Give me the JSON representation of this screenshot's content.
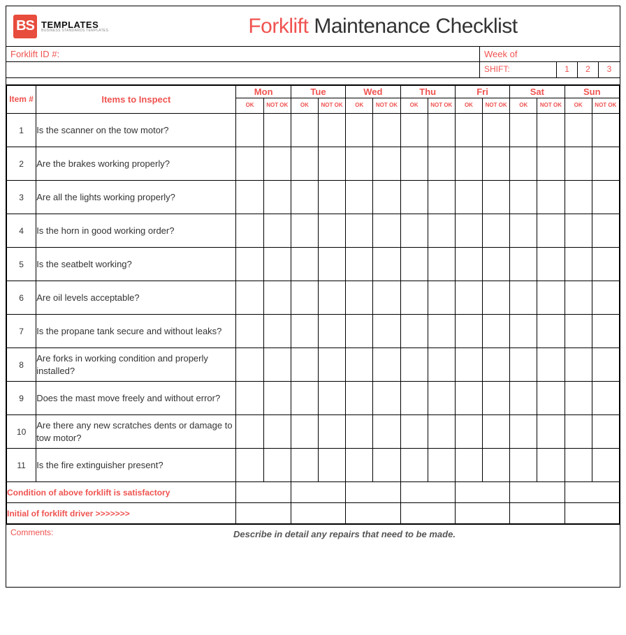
{
  "logo": {
    "initials": "BS",
    "main": "TEMPLATES",
    "sub": "BUSINESS STANDARDS TEMPLATES"
  },
  "title": {
    "highlight": "Forklift",
    "rest": "Maintenance Checklist"
  },
  "meta": {
    "forklift_id_label": "Forklift ID #:",
    "forklift_id_value": "",
    "week_label": "Week of",
    "week_value": "",
    "shift_label": "SHIFT:",
    "shifts": [
      "1",
      "2",
      "3"
    ]
  },
  "headers": {
    "item_no": "Item #",
    "items_to_inspect": "Items to Inspect",
    "days": [
      "Mon",
      "Tue",
      "Wed",
      "Thu",
      "Fri",
      "Sat",
      "Sun"
    ],
    "ok": "OK",
    "not_ok": "NOT OK"
  },
  "rows": [
    {
      "n": "1",
      "text": "Is the scanner on the tow motor?"
    },
    {
      "n": "2",
      "text": "Are the brakes working properly?"
    },
    {
      "n": "3",
      "text": "Are all the lights working properly?"
    },
    {
      "n": "4",
      "text": "Is the horn in good working order?"
    },
    {
      "n": "5",
      "text": "Is the seatbelt working?"
    },
    {
      "n": "6",
      "text": "Are oil levels acceptable?"
    },
    {
      "n": "7",
      "text": "Is the propane tank secure and without leaks?"
    },
    {
      "n": "8",
      "text": "Are forks in working condition and properly installed?"
    },
    {
      "n": "9",
      "text": "Does the mast move freely and without error?"
    },
    {
      "n": "10",
      "text": "Are there any new scratches dents or damage to tow motor?"
    },
    {
      "n": "11",
      "text": "Is the fire extinguisher present?"
    }
  ],
  "footer_rows": {
    "condition": "Condition of above forklift is satisfactory",
    "initial": "Initial of forklift driver >>>>>>>"
  },
  "comments": {
    "label": "Comments:",
    "hint": "Describe in detail any repairs that need to be made."
  }
}
